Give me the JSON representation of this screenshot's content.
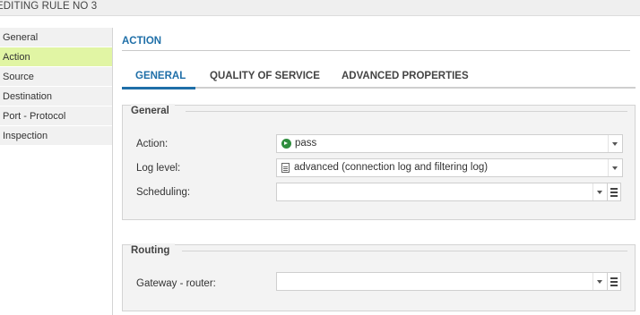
{
  "window": {
    "title": "EDITING RULE NO 3"
  },
  "sidebar": {
    "items": [
      {
        "label": "General"
      },
      {
        "label": "Action"
      },
      {
        "label": "Source"
      },
      {
        "label": "Destination"
      },
      {
        "label": "Port - Protocol"
      },
      {
        "label": "Inspection"
      }
    ],
    "active": "Action"
  },
  "section": {
    "title": "ACTION"
  },
  "tabs": [
    {
      "label": "GENERAL"
    },
    {
      "label": "QUALITY OF SERVICE"
    },
    {
      "label": "ADVANCED PROPERTIES"
    }
  ],
  "active_tab": "GENERAL",
  "general_group": {
    "legend": "General",
    "action": {
      "label": "Action:",
      "value": "pass",
      "icon": "pass-arrow-icon"
    },
    "log_level": {
      "label": "Log level:",
      "value": "advanced (connection log and filtering log)",
      "icon": "document-icon"
    },
    "scheduling": {
      "label": "Scheduling:",
      "value": ""
    }
  },
  "routing_group": {
    "legend": "Routing",
    "gateway": {
      "label": "Gateway - router:",
      "value": ""
    }
  },
  "colors": {
    "accent": "#1f6fa8",
    "active_item": "#e1f5a4",
    "pass_icon": "#2f8d3e"
  }
}
